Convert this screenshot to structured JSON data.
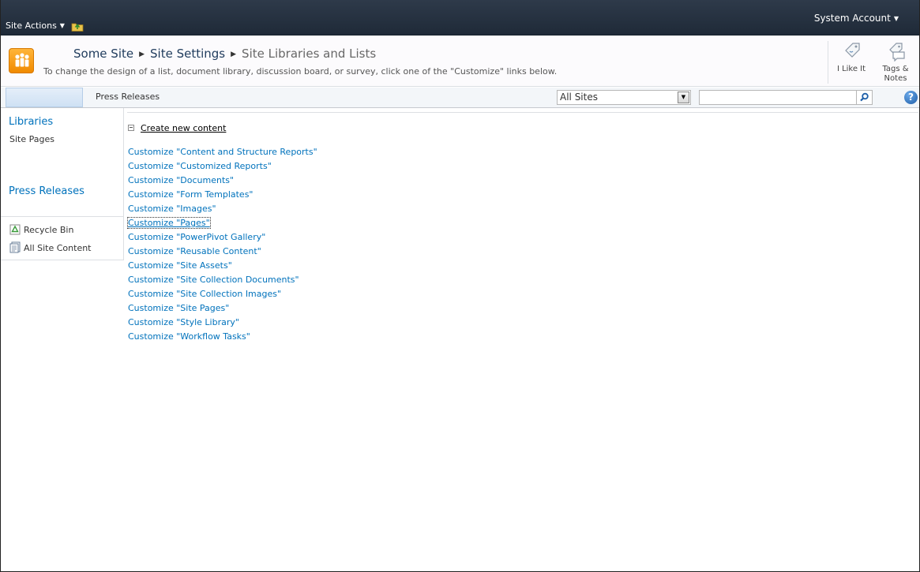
{
  "ribbon": {
    "site_actions_label": "Site Actions",
    "user_label": "System Account"
  },
  "title_area": {
    "breadcrumb": [
      "Some Site",
      "Site Settings",
      "Site Libraries and Lists"
    ],
    "description": "To change the design of a list, document library, discussion board, or survey, click one of the \"Customize\" links below.",
    "social": {
      "like_label": "I Like It",
      "tags_label_line1": "Tags &",
      "tags_label_line2": "Notes"
    }
  },
  "topnav": {
    "items": [
      "Press Releases"
    ],
    "search_scope": "All Sites",
    "search_value": ""
  },
  "quicklaunch": {
    "libraries_heading": "Libraries",
    "library_items": [
      "Site Pages"
    ],
    "press_releases_heading": "Press Releases",
    "tools": [
      "Recycle Bin",
      "All Site Content"
    ]
  },
  "content": {
    "section_title": "Create new content",
    "links": [
      "Customize \"Content and Structure Reports\"",
      "Customize \"Customized Reports\"",
      "Customize \"Documents\"",
      "Customize \"Form Templates\"",
      "Customize \"Images\"",
      "Customize \"Pages\"",
      "Customize \"PowerPivot Gallery\"",
      "Customize \"Reusable Content\"",
      "Customize \"Site Assets\"",
      "Customize \"Site Collection Documents\"",
      "Customize \"Site Collection Images\"",
      "Customize \"Site Pages\"",
      "Customize \"Style Library\"",
      "Customize \"Workflow Tasks\""
    ],
    "focused_index": 5
  },
  "colors": {
    "ribbon_bg": "#1f2a38",
    "link": "#0072bc",
    "logo": "#f08a00"
  }
}
